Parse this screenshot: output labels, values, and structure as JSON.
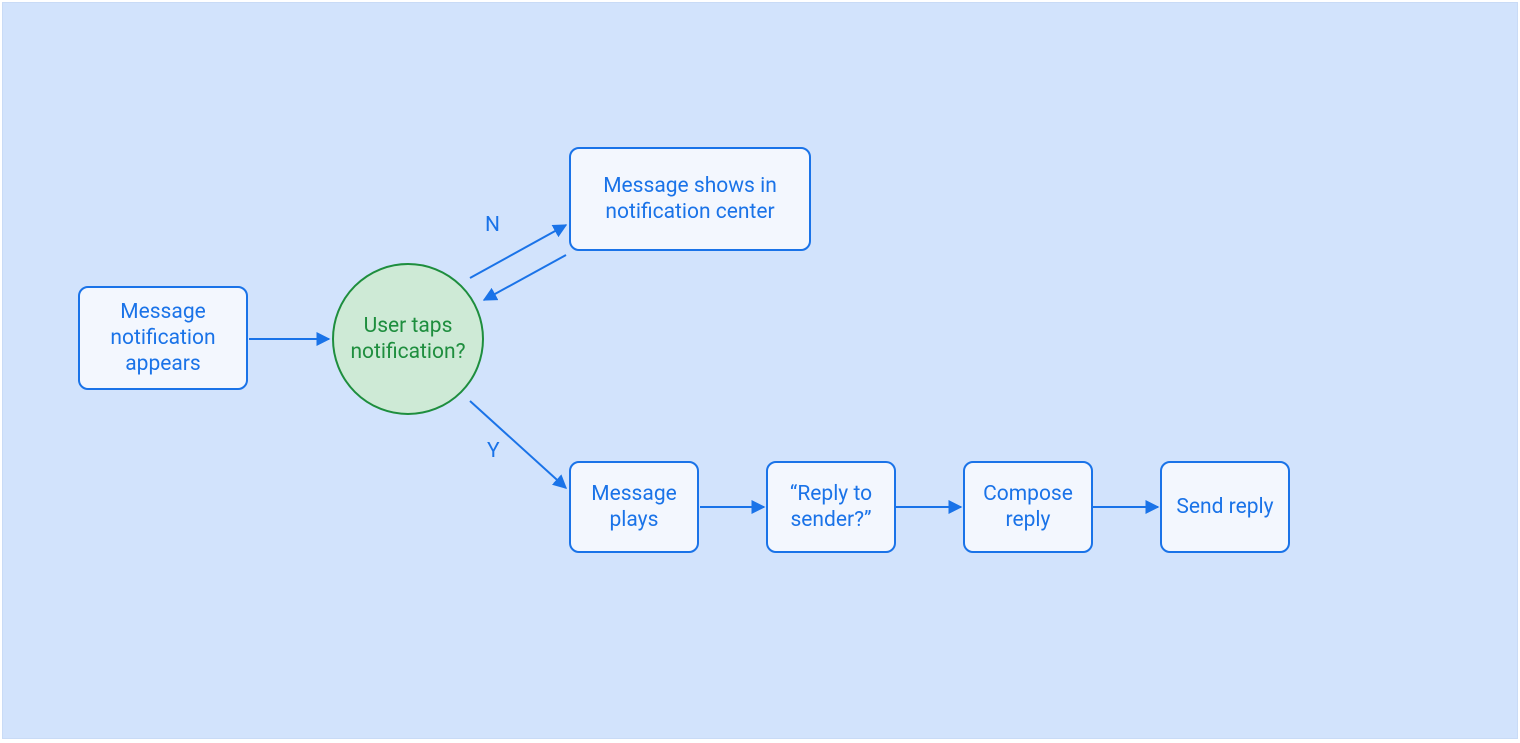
{
  "diagram": {
    "nodes": {
      "start": "Message notification appears",
      "decision": "User taps notification?",
      "no_branch": "Message shows in notification center",
      "yes_1": "Message plays",
      "yes_2": "“Reply to sender?”",
      "yes_3": "Compose reply",
      "yes_4": "Send reply"
    },
    "labels": {
      "no": "N",
      "yes": "Y"
    }
  },
  "chart_data": {
    "type": "flowchart",
    "nodes": [
      {
        "id": "start",
        "kind": "process",
        "label": "Message notification appears"
      },
      {
        "id": "decision",
        "kind": "decision",
        "label": "User taps notification?"
      },
      {
        "id": "no_branch",
        "kind": "process",
        "label": "Message shows in notification center"
      },
      {
        "id": "yes_1",
        "kind": "process",
        "label": "Message plays"
      },
      {
        "id": "yes_2",
        "kind": "process",
        "label": "“Reply to sender?”"
      },
      {
        "id": "yes_3",
        "kind": "process",
        "label": "Compose reply"
      },
      {
        "id": "yes_4",
        "kind": "process",
        "label": "Send reply"
      }
    ],
    "edges": [
      {
        "from": "start",
        "to": "decision",
        "label": ""
      },
      {
        "from": "decision",
        "to": "no_branch",
        "label": "N"
      },
      {
        "from": "no_branch",
        "to": "decision",
        "label": ""
      },
      {
        "from": "decision",
        "to": "yes_1",
        "label": "Y"
      },
      {
        "from": "yes_1",
        "to": "yes_2",
        "label": ""
      },
      {
        "from": "yes_2",
        "to": "yes_3",
        "label": ""
      },
      {
        "from": "yes_3",
        "to": "yes_4",
        "label": ""
      }
    ]
  }
}
